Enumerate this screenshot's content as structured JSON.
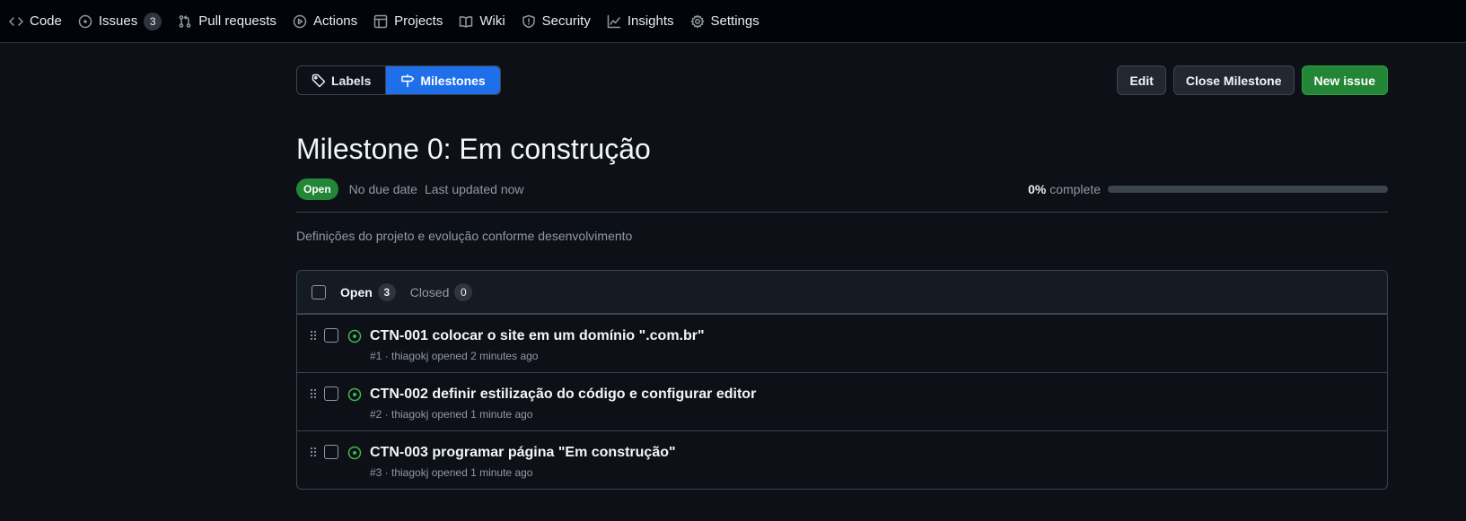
{
  "repo_nav": {
    "items": [
      {
        "label": "Code",
        "icon": "code-icon"
      },
      {
        "label": "Issues",
        "icon": "issue-opened-icon",
        "count": "3"
      },
      {
        "label": "Pull requests",
        "icon": "pull-request-icon"
      },
      {
        "label": "Actions",
        "icon": "play-icon"
      },
      {
        "label": "Projects",
        "icon": "table-icon"
      },
      {
        "label": "Wiki",
        "icon": "book-icon"
      },
      {
        "label": "Security",
        "icon": "shield-icon"
      },
      {
        "label": "Insights",
        "icon": "graph-icon"
      },
      {
        "label": "Settings",
        "icon": "gear-icon"
      }
    ]
  },
  "subnav": {
    "labels": "Labels",
    "milestones": "Milestones",
    "selected": "Milestones"
  },
  "buttons": {
    "edit": "Edit",
    "close_milestone": "Close Milestone",
    "new_issue": "New issue"
  },
  "milestone": {
    "title": "Milestone 0: Em construção",
    "state": "Open",
    "due": "No due date",
    "updated": "Last updated now",
    "percent_text": "0%",
    "complete_label": "complete",
    "progress": 0,
    "description": "Definições do projeto e evolução conforme desenvolvimento"
  },
  "issues_box": {
    "open_label": "Open",
    "open_count": "3",
    "closed_label": "Closed",
    "closed_count": "0",
    "rows": [
      {
        "title": "CTN-001 colocar o site em um domínio \".com.br\"",
        "meta": "#1 · thiagokj opened 2 minutes ago"
      },
      {
        "title": "CTN-002 definir estilização do código e configurar editor",
        "meta": "#2 · thiagokj opened 1 minute ago"
      },
      {
        "title": "CTN-003 programar página \"Em construção\"",
        "meta": "#3 · thiagokj opened 1 minute ago"
      }
    ]
  },
  "colors": {
    "background": "#0d1117",
    "accent_blue": "#1f6feb",
    "success_green": "#238636",
    "open_issue_green": "#3fb950"
  }
}
